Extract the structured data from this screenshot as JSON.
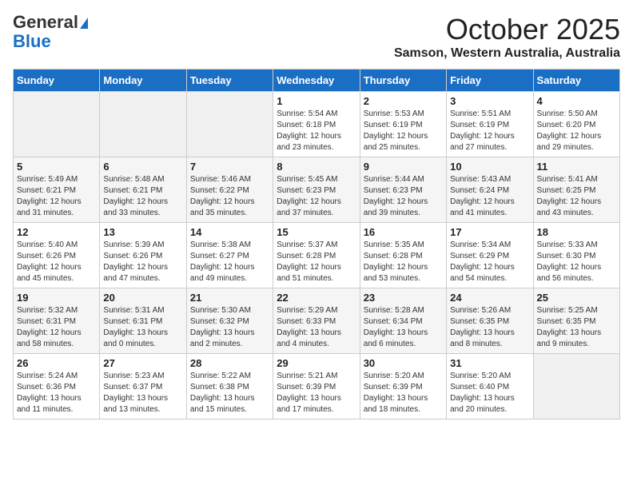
{
  "header": {
    "logo_general": "General",
    "logo_blue": "Blue",
    "month_title": "October 2025",
    "location": "Samson, Western Australia, Australia"
  },
  "days_of_week": [
    "Sunday",
    "Monday",
    "Tuesday",
    "Wednesday",
    "Thursday",
    "Friday",
    "Saturday"
  ],
  "weeks": [
    [
      {
        "day": "",
        "info": ""
      },
      {
        "day": "",
        "info": ""
      },
      {
        "day": "",
        "info": ""
      },
      {
        "day": "1",
        "info": "Sunrise: 5:54 AM\nSunset: 6:18 PM\nDaylight: 12 hours\nand 23 minutes."
      },
      {
        "day": "2",
        "info": "Sunrise: 5:53 AM\nSunset: 6:19 PM\nDaylight: 12 hours\nand 25 minutes."
      },
      {
        "day": "3",
        "info": "Sunrise: 5:51 AM\nSunset: 6:19 PM\nDaylight: 12 hours\nand 27 minutes."
      },
      {
        "day": "4",
        "info": "Sunrise: 5:50 AM\nSunset: 6:20 PM\nDaylight: 12 hours\nand 29 minutes."
      }
    ],
    [
      {
        "day": "5",
        "info": "Sunrise: 5:49 AM\nSunset: 6:21 PM\nDaylight: 12 hours\nand 31 minutes."
      },
      {
        "day": "6",
        "info": "Sunrise: 5:48 AM\nSunset: 6:21 PM\nDaylight: 12 hours\nand 33 minutes."
      },
      {
        "day": "7",
        "info": "Sunrise: 5:46 AM\nSunset: 6:22 PM\nDaylight: 12 hours\nand 35 minutes."
      },
      {
        "day": "8",
        "info": "Sunrise: 5:45 AM\nSunset: 6:23 PM\nDaylight: 12 hours\nand 37 minutes."
      },
      {
        "day": "9",
        "info": "Sunrise: 5:44 AM\nSunset: 6:23 PM\nDaylight: 12 hours\nand 39 minutes."
      },
      {
        "day": "10",
        "info": "Sunrise: 5:43 AM\nSunset: 6:24 PM\nDaylight: 12 hours\nand 41 minutes."
      },
      {
        "day": "11",
        "info": "Sunrise: 5:41 AM\nSunset: 6:25 PM\nDaylight: 12 hours\nand 43 minutes."
      }
    ],
    [
      {
        "day": "12",
        "info": "Sunrise: 5:40 AM\nSunset: 6:26 PM\nDaylight: 12 hours\nand 45 minutes."
      },
      {
        "day": "13",
        "info": "Sunrise: 5:39 AM\nSunset: 6:26 PM\nDaylight: 12 hours\nand 47 minutes."
      },
      {
        "day": "14",
        "info": "Sunrise: 5:38 AM\nSunset: 6:27 PM\nDaylight: 12 hours\nand 49 minutes."
      },
      {
        "day": "15",
        "info": "Sunrise: 5:37 AM\nSunset: 6:28 PM\nDaylight: 12 hours\nand 51 minutes."
      },
      {
        "day": "16",
        "info": "Sunrise: 5:35 AM\nSunset: 6:28 PM\nDaylight: 12 hours\nand 53 minutes."
      },
      {
        "day": "17",
        "info": "Sunrise: 5:34 AM\nSunset: 6:29 PM\nDaylight: 12 hours\nand 54 minutes."
      },
      {
        "day": "18",
        "info": "Sunrise: 5:33 AM\nSunset: 6:30 PM\nDaylight: 12 hours\nand 56 minutes."
      }
    ],
    [
      {
        "day": "19",
        "info": "Sunrise: 5:32 AM\nSunset: 6:31 PM\nDaylight: 12 hours\nand 58 minutes."
      },
      {
        "day": "20",
        "info": "Sunrise: 5:31 AM\nSunset: 6:31 PM\nDaylight: 13 hours\nand 0 minutes."
      },
      {
        "day": "21",
        "info": "Sunrise: 5:30 AM\nSunset: 6:32 PM\nDaylight: 13 hours\nand 2 minutes."
      },
      {
        "day": "22",
        "info": "Sunrise: 5:29 AM\nSunset: 6:33 PM\nDaylight: 13 hours\nand 4 minutes."
      },
      {
        "day": "23",
        "info": "Sunrise: 5:28 AM\nSunset: 6:34 PM\nDaylight: 13 hours\nand 6 minutes."
      },
      {
        "day": "24",
        "info": "Sunrise: 5:26 AM\nSunset: 6:35 PM\nDaylight: 13 hours\nand 8 minutes."
      },
      {
        "day": "25",
        "info": "Sunrise: 5:25 AM\nSunset: 6:35 PM\nDaylight: 13 hours\nand 9 minutes."
      }
    ],
    [
      {
        "day": "26",
        "info": "Sunrise: 5:24 AM\nSunset: 6:36 PM\nDaylight: 13 hours\nand 11 minutes."
      },
      {
        "day": "27",
        "info": "Sunrise: 5:23 AM\nSunset: 6:37 PM\nDaylight: 13 hours\nand 13 minutes."
      },
      {
        "day": "28",
        "info": "Sunrise: 5:22 AM\nSunset: 6:38 PM\nDaylight: 13 hours\nand 15 minutes."
      },
      {
        "day": "29",
        "info": "Sunrise: 5:21 AM\nSunset: 6:39 PM\nDaylight: 13 hours\nand 17 minutes."
      },
      {
        "day": "30",
        "info": "Sunrise: 5:20 AM\nSunset: 6:39 PM\nDaylight: 13 hours\nand 18 minutes."
      },
      {
        "day": "31",
        "info": "Sunrise: 5:20 AM\nSunset: 6:40 PM\nDaylight: 13 hours\nand 20 minutes."
      },
      {
        "day": "",
        "info": ""
      }
    ]
  ]
}
